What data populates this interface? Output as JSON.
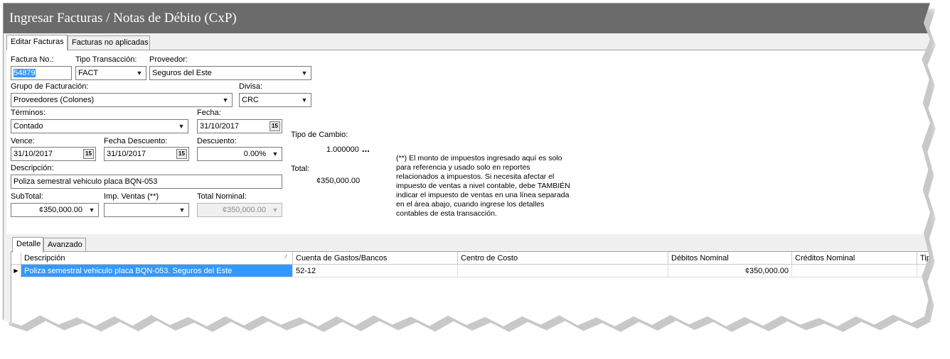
{
  "window": {
    "title": "Ingresar Facturas / Notas de Débito (CxP)"
  },
  "tabs_top": [
    {
      "label": "Editar Facturas",
      "active": true
    },
    {
      "label": "Facturas no aplicadas",
      "active": false
    }
  ],
  "form": {
    "factura_no": {
      "label": "Factura No.:",
      "value": "54879"
    },
    "tipo_transaccion": {
      "label": "Tipo Transacción:",
      "value": "FACT"
    },
    "proveedor": {
      "label": "Proveedor:",
      "value": "Seguros del Este"
    },
    "grupo_facturacion": {
      "label": "Grupo de Facturación:",
      "value": "Proveedores (Colones)"
    },
    "divisa": {
      "label": "Divisa:",
      "value": "CRC"
    },
    "terminos": {
      "label": "Términos:",
      "value": "Contado"
    },
    "fecha": {
      "label": "Fecha:",
      "value": "31/10/2017"
    },
    "vence": {
      "label": "Vence:",
      "value": "31/10/2017"
    },
    "fecha_descuento": {
      "label": "Fecha Descuento:",
      "value": "31/10/2017"
    },
    "descuento": {
      "label": "Descuento:",
      "value": "0.00%"
    },
    "descripcion": {
      "label": "Descripción:",
      "value": "Poliza semestral vehiculo placa BQN-053"
    },
    "subtotal": {
      "label": "SubTotal:",
      "value": "¢350,000.00"
    },
    "imp_ventas": {
      "label": "Imp. Ventas (**)",
      "value": ""
    },
    "total_nominal": {
      "label": "Total Nominal:",
      "value": "¢350,000.00"
    },
    "tipo_cambio": {
      "label": "Tipo de Cambio:",
      "value": "1.000000",
      "more": "..."
    },
    "total": {
      "label": "Total:",
      "value": "¢350,000.00"
    },
    "note": "(**) El monto de impuestos ingresado aquí es solo para referencia y usado solo en reportes relacionados a impuestos. Si necesita afectar el impuesto de ventas a nivel contable, debe TAMBIÉN indicar el impuesto de ventas en una línea separada en el área abajo, cuando ingrese los detalles contables de esta transacción."
  },
  "tabs_bottom": [
    {
      "label": "Detalle",
      "active": true
    },
    {
      "label": "Avanzado",
      "active": false
    }
  ],
  "grid": {
    "columns": [
      "Descripción",
      "Cuenta de Gastos/Bancos",
      "Centro de Costo",
      "Débitos Nominal",
      "Créditos Nominal",
      "Tipo"
    ],
    "rows": [
      {
        "descripcion": "Poliza semestral vehiculo placa BQN-053. Seguros del Este",
        "cuenta": "52-12",
        "centro_costo": "",
        "debitos": "¢350,000.00",
        "creditos": ""
      }
    ]
  }
}
